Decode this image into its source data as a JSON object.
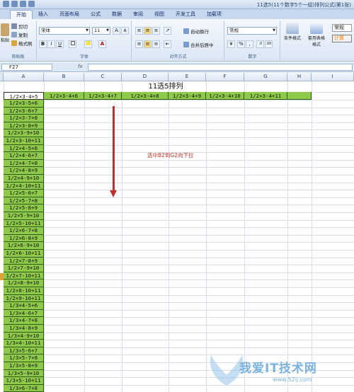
{
  "window": {
    "title": "11选5(11个数字5个一组)排列公式(第1张)"
  },
  "tabs": [
    {
      "label": "开始"
    },
    {
      "label": "插入"
    },
    {
      "label": "页面布局"
    },
    {
      "label": "公式"
    },
    {
      "label": "数据"
    },
    {
      "label": "审阅"
    },
    {
      "label": "视图"
    },
    {
      "label": "开发工具"
    },
    {
      "label": "加载项"
    }
  ],
  "ribbon": {
    "clipboard": {
      "paste": "粘贴",
      "cut": "剪切",
      "copy": "复制",
      "format_painter": "格式刷",
      "label": "剪贴板"
    },
    "font": {
      "name": "宋体",
      "size": "11",
      "grow": "A",
      "shrink": "A",
      "bold": "B",
      "italic": "I",
      "underline": "U",
      "label": "字体"
    },
    "alignment": {
      "wrap": "自动换行",
      "merge": "合并后居中",
      "label": "对齐方式"
    },
    "number": {
      "format": "常规",
      "percent": "%",
      "comma": ",",
      "label": "数字"
    },
    "styles": {
      "conditional": "条件格式",
      "table": "套用表格格式",
      "normal": "常规",
      "calc": "计算"
    }
  },
  "formula_bar": {
    "cell_ref": "F27",
    "fx": "fx",
    "formula": ""
  },
  "columns": [
    "A",
    "B",
    "C",
    "D",
    "E",
    "F",
    "G",
    "H",
    "I"
  ],
  "sheet": {
    "title": "11选5排列",
    "header_row": [
      "1/2×3-4+5",
      "1/2×3-4+6",
      "1/2×3-4+7",
      "1/2×3-4+8",
      "1/2×3-4+9",
      "1/2×3-4+10",
      "1/2×3-4+11"
    ],
    "col_a": [
      "1/2×3-5+6",
      "1/2×3-6+7",
      "1/2×3-7+8",
      "1/2×3-8+9",
      "1/2×3-9+10",
      "1/2×3-10+11",
      "1/2×4-5+6",
      "1/2×4-6+7",
      "1/2×4-7+8",
      "1/2×4-8+9",
      "1/2×4-9+10",
      "1/2×4-10+11",
      "1/2×5-6+7",
      "1/2×5-7+8",
      "1/2×5-8+9",
      "1/2×5-9+10",
      "1/2×5-10+11",
      "1/2×6-7+8",
      "1/2×6-8+9",
      "1/2×6-9+10",
      "1/2×6-10+11",
      "1/2×7-8+9",
      "1/2×7-9+10",
      "1/2×7-10+11",
      "1/2×8-9+10",
      "1/2×8-10+11",
      "1/2×9-10+11",
      "1/3×4-5+6",
      "1/3×4-6+7",
      "1/3×4-7+8",
      "1/3×4-8+9",
      "1/3×4-9+10",
      "1/3×4-10+11",
      "1/3×5-6+7",
      "1/3×5-7+8",
      "1/3×5-8+9",
      "1/3×5-9+10",
      "1/3×5-10+11",
      "1/3×6-7+8"
    ]
  },
  "annotation": {
    "text": "选中B2到G2向下拉"
  },
  "watermark": {
    "text": "我爱IT技术网",
    "url": "www.52ij.com"
  }
}
